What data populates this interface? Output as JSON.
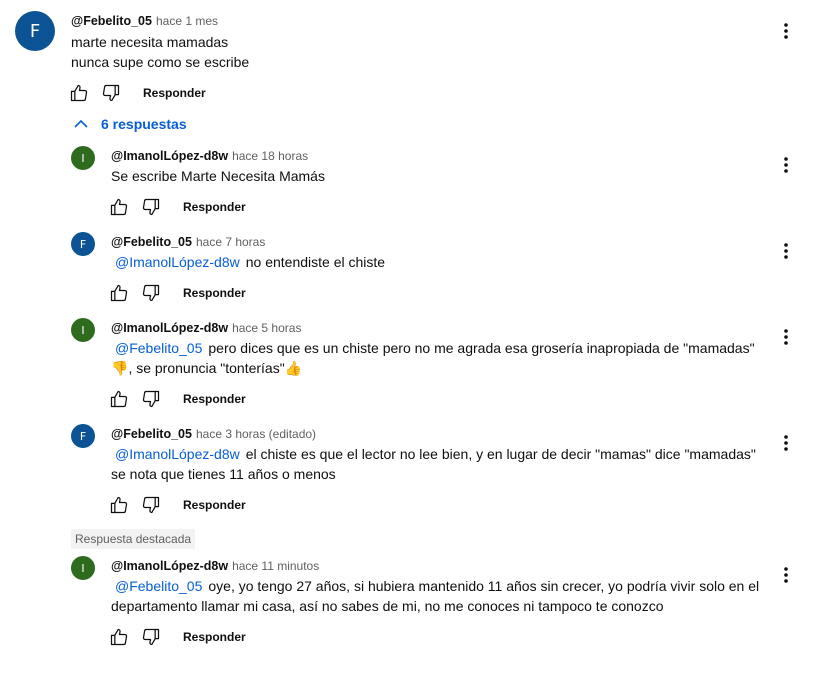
{
  "colors": {
    "avatar_blue": "#0b5394",
    "avatar_green": "#2e6b1f",
    "link": "#065fd4"
  },
  "icons": {
    "like": "thumb-up-icon",
    "dislike": "thumb-down-icon",
    "menu": "more-vert-icon",
    "toggle": "chevron-up-icon"
  },
  "main_comment": {
    "avatar_letter": "F",
    "author": "@Febelito_05",
    "time": "hace 1 mes",
    "line1": "marte necesita mamadas",
    "line2": "nunca supe como se escribe",
    "reply_label": "Responder"
  },
  "replies_toggle": {
    "label": "6 respuestas"
  },
  "replies": [
    {
      "avatar_letter": "I",
      "author": "@ImanolLópez-d8w",
      "time": "hace 18 horas",
      "mention": "",
      "line1": "Se escribe Marte Necesita Mamás",
      "line2": "",
      "reply_label": "Responder"
    },
    {
      "avatar_letter": "F",
      "author": "@Febelito_05",
      "time": "hace 7 horas",
      "mention": "@ImanolLópez-d8w",
      "line1": "no entendiste el chiste",
      "line2": "",
      "reply_label": "Responder"
    },
    {
      "avatar_letter": "I",
      "author": "@ImanolLópez-d8w",
      "time": "hace 5 horas",
      "mention": "@Febelito_05",
      "line1": "pero dices que es un chiste pero no me agrada esa grosería inapropiada de \"mamadas\"",
      "line2_emoji1": "👎",
      "line2": ", se pronuncia \"tonterías\"",
      "line2_emoji2": "👍",
      "reply_label": "Responder"
    },
    {
      "avatar_letter": "F",
      "author": "@Febelito_05",
      "time": "hace 3 horas (editado)",
      "mention": "@ImanolLópez-d8w",
      "line1": "el chiste es que el lector no lee bien, y en lugar de decir \"mamas\" dice \"mamadas\"",
      "line2": "se nota que tienes 11 años o menos",
      "reply_label": "Responder"
    },
    {
      "avatar_letter": "I",
      "author": "@ImanolLópez-d8w",
      "time": "hace 11 minutos",
      "badge": "Respuesta destacada",
      "mention": "@Febelito_05",
      "line1": "oye, yo tengo 27 años, si hubiera mantenido 11 años sin crecer, yo podría vivir solo en el",
      "line2": "departamento llamar mi casa, así no sabes de mi, no me conoces ni tampoco te conozco",
      "reply_label": "Responder"
    }
  ]
}
